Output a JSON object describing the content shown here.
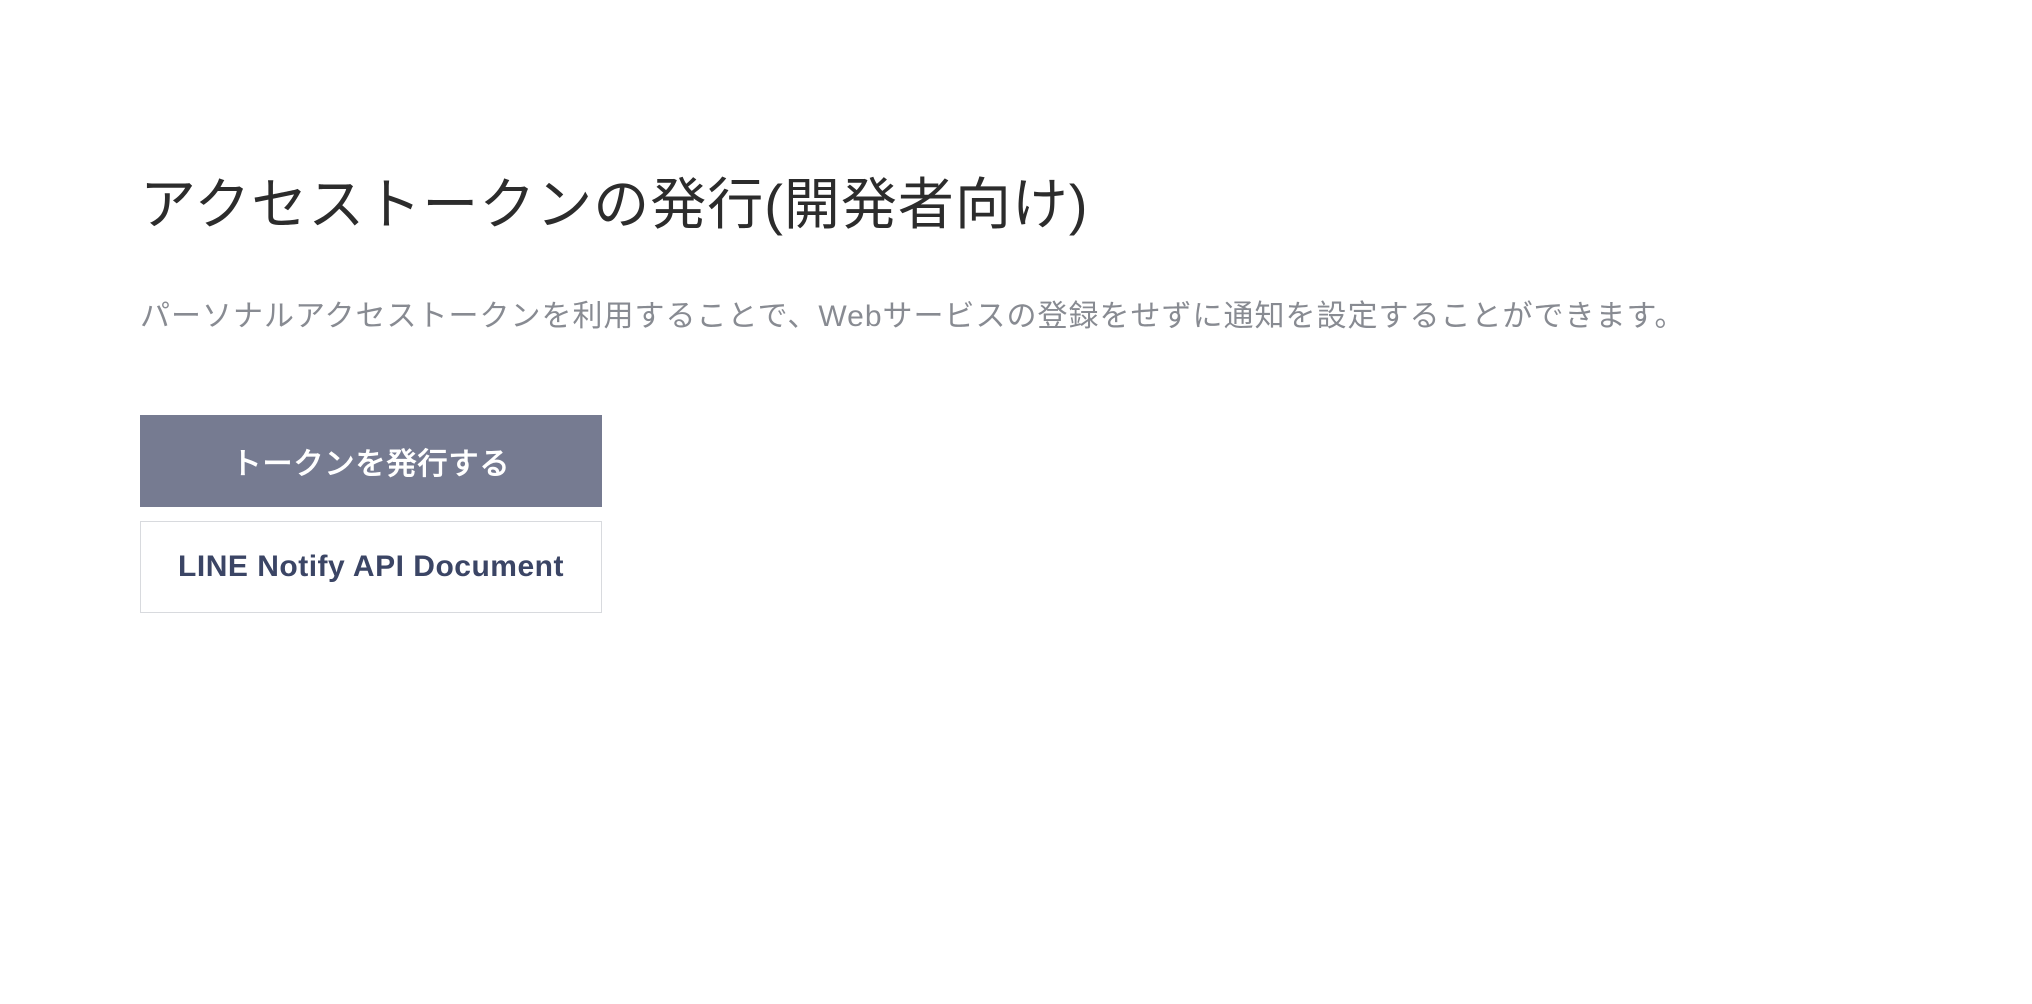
{
  "title": "アクセストークンの発行(開発者向け)",
  "description": "パーソナルアクセストークンを利用することで、Webサービスの登録をせずに通知を設定することができます。",
  "buttons": {
    "issue_token": "トークンを発行する",
    "api_document": "LINE Notify API Document"
  }
}
